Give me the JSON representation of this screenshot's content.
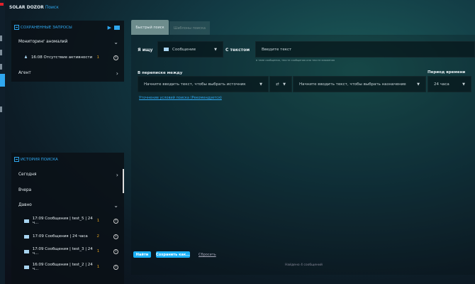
{
  "header": {
    "app": "SOLAR DOZOR",
    "section": "Поиск"
  },
  "saved": {
    "title": "СОХРАНЕННЫЕ ЗАПРОСЫ",
    "groups": [
      {
        "label": "Мониторинг аномалий",
        "items": [
          {
            "text": "16:08 Отсутствие активности",
            "count": "1"
          }
        ]
      },
      {
        "label": "Агент"
      }
    ]
  },
  "history": {
    "title": "ИСТОРИЯ ПОИСКА",
    "groups": [
      "Сегодня",
      "Вчера",
      "Давно"
    ],
    "items": [
      {
        "text": "17:09 Сообщения | test_5 | 24 ч...",
        "count": "1"
      },
      {
        "text": "17:09 Сообщения | 24 часа",
        "count": "2"
      },
      {
        "text": "17:09 Сообщения | test_3 | 24 ч...",
        "count": "1"
      },
      {
        "text": "16:09 Сообщения | test_2 | 24 ч...",
        "count": "1"
      }
    ]
  },
  "tabs": [
    "Быстрый поиск",
    "Шаблоны поиска"
  ],
  "form": {
    "seek_label": "Я ищу",
    "seek_value": "Сообщение",
    "text_label": "С текстом",
    "text_placeholder": "Введите текст",
    "hint": "в теме сообщения, тексте сообщения или тексте вложения",
    "between_label": "В переписке между",
    "source_placeholder": "Начните вводить текст, чтобы выбрать источник",
    "dest_placeholder": "Начните вводить текст, чтобы выбрать назначение",
    "period_label": "Период времени",
    "period_value": "24 часа",
    "refine_link": "Уточнение условий поиска (Рекомендуется)"
  },
  "actions": {
    "find": "Найти",
    "save_as": "Сохранить как...",
    "reset": "Сбросить"
  },
  "status": "Найдено 4 сообщений",
  "colors": {
    "accent": "#2fa8f0",
    "count": "#e0a020",
    "button": "#1ab0f5"
  }
}
